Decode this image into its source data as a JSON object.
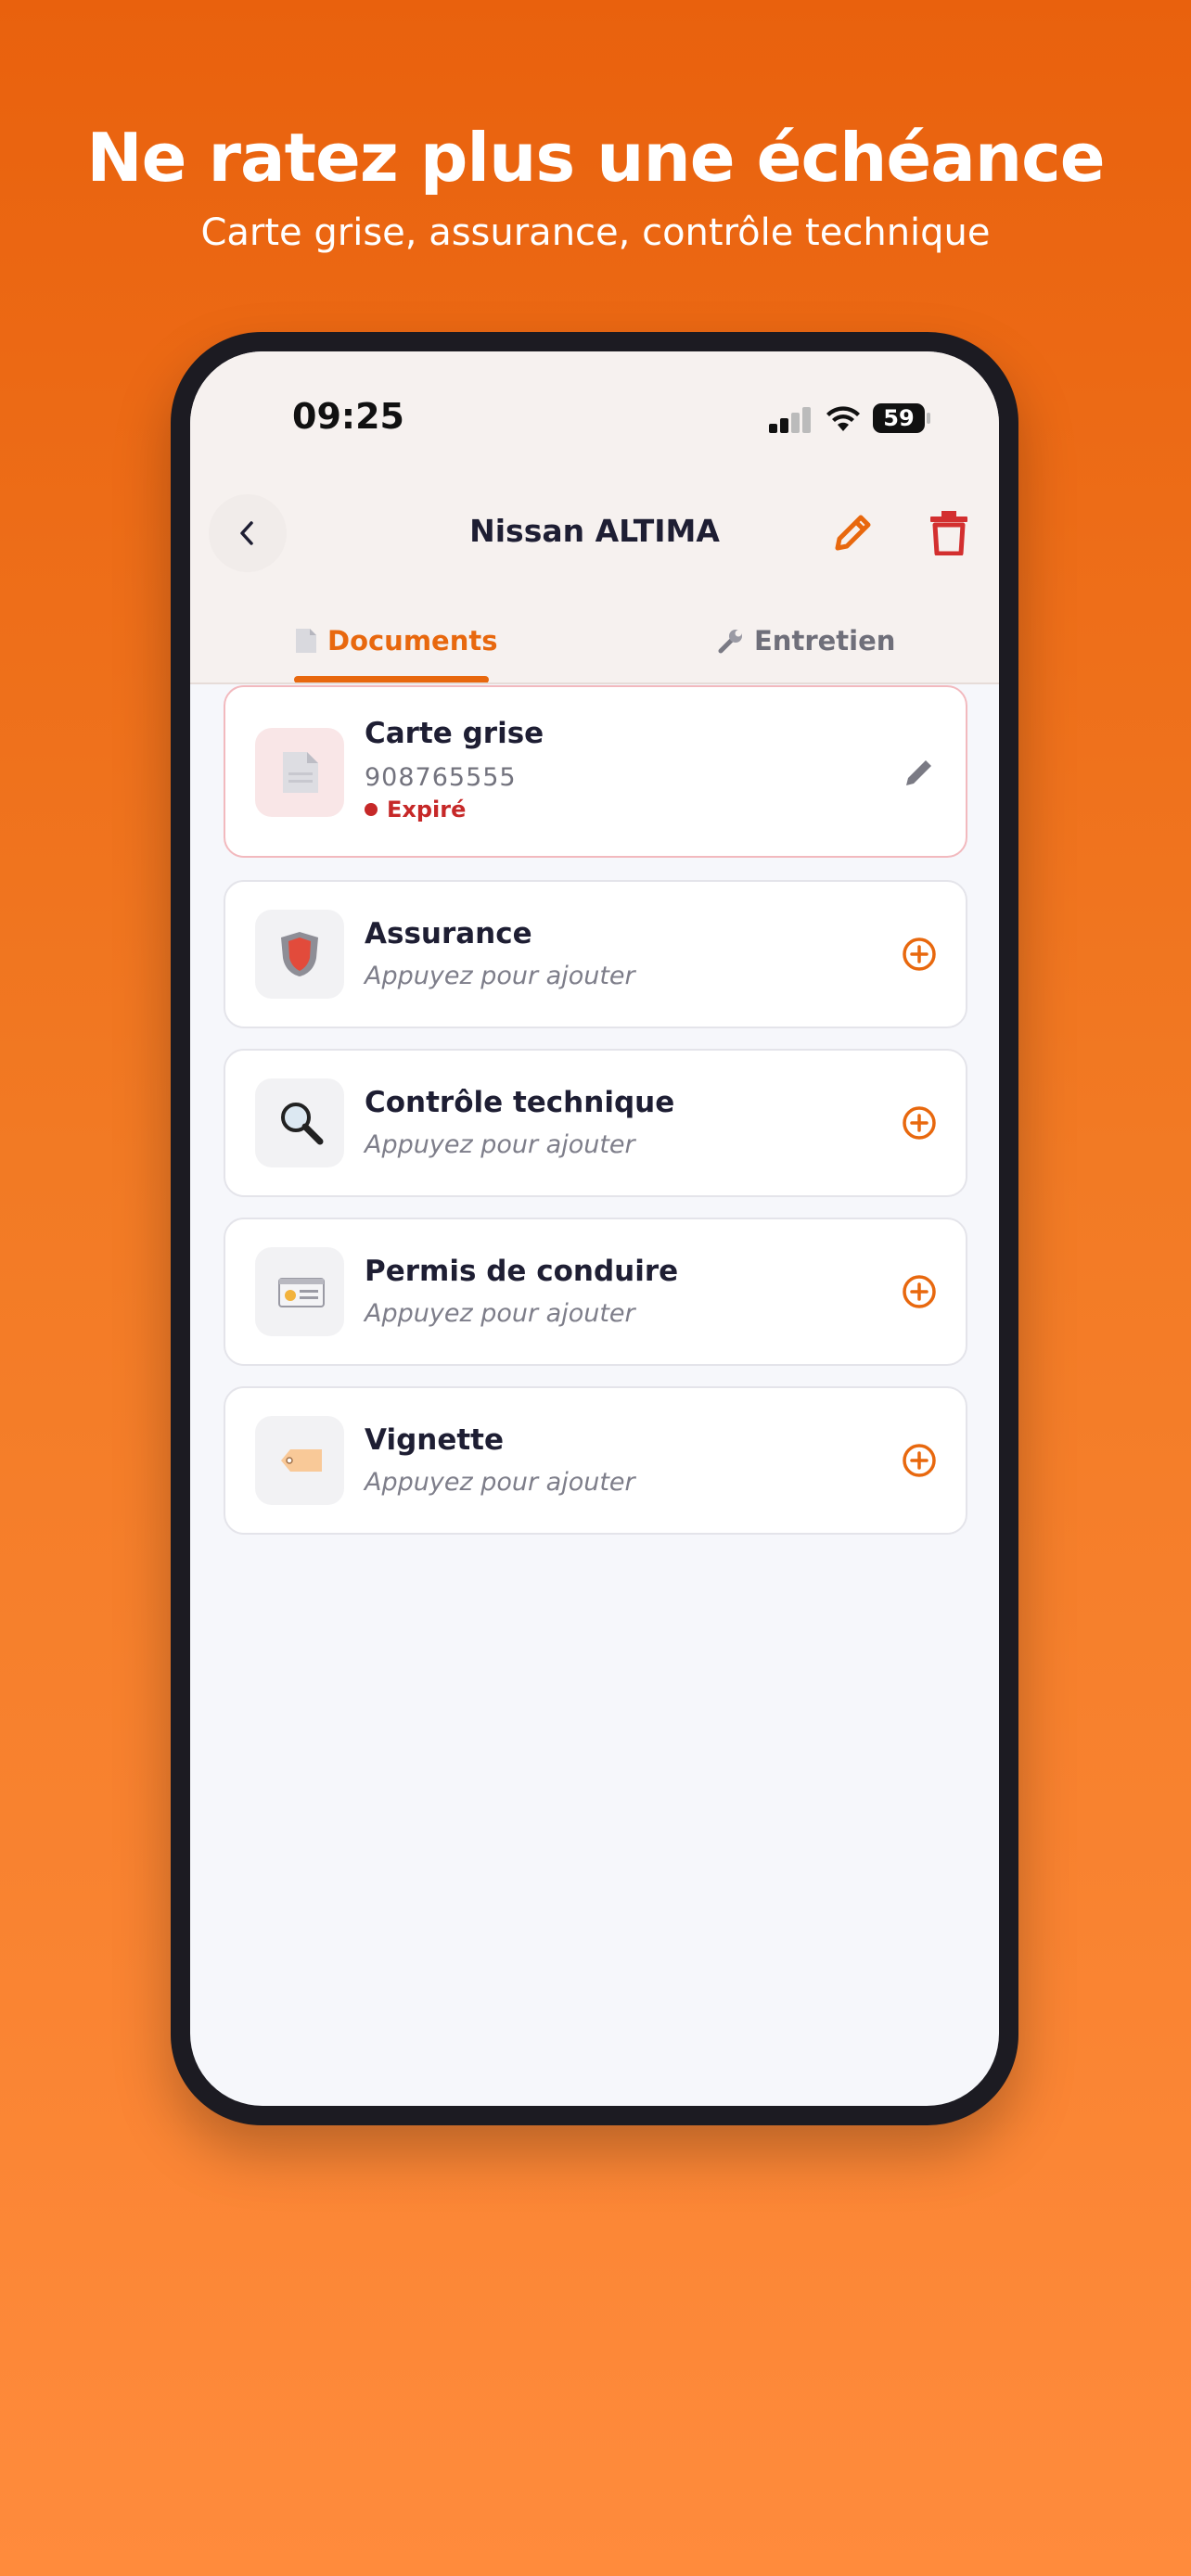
{
  "promo": {
    "headline": "Ne ratez plus une échéance",
    "subline": "Carte grise, assurance, contrôle technique"
  },
  "status_bar": {
    "time": "09:25",
    "battery": "59"
  },
  "nav": {
    "title": "Nissan ALTIMA"
  },
  "tabs": [
    {
      "label": "Documents",
      "icon": "document-icon",
      "active": true
    },
    {
      "label": "Entretien",
      "icon": "wrench-icon",
      "active": false
    }
  ],
  "documents": [
    {
      "title": "Carte grise",
      "number": "908765555",
      "status": "Expiré",
      "icon": "document-icon",
      "action": "edit"
    },
    {
      "title": "Assurance",
      "subtitle": "Appuyez pour ajouter",
      "icon": "shield-icon",
      "action": "add"
    },
    {
      "title": "Contrôle technique",
      "subtitle": "Appuyez pour ajouter",
      "icon": "magnifier-icon",
      "action": "add"
    },
    {
      "title": "Permis de conduire",
      "subtitle": "Appuyez pour ajouter",
      "icon": "id-card-icon",
      "action": "add"
    },
    {
      "title": "Vignette",
      "subtitle": "Appuyez pour ajouter",
      "icon": "tag-icon",
      "action": "add"
    }
  ],
  "colors": {
    "accent": "#E8680E",
    "danger": "#C62828",
    "background_top": "#E9610D",
    "background_bottom": "#FF8B3C"
  }
}
